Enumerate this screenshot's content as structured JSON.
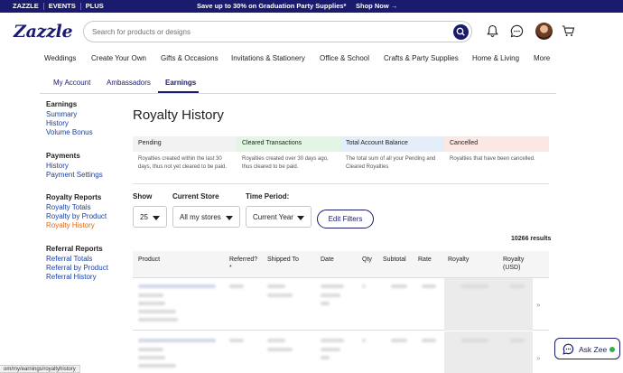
{
  "topbar": {
    "links": [
      "ZAZZLE",
      "EVENTS",
      "PLUS"
    ],
    "promo": "Save up to 30% on Graduation Party Supplies*",
    "shop_now": "Shop Now →",
    "bg_color": "#1a1a6e"
  },
  "header": {
    "logo": "Zazzle",
    "search_placeholder": "Search for products or designs",
    "icons": [
      "search-icon",
      "bell-icon",
      "chat-bubble-icon",
      "avatar",
      "cart-icon"
    ]
  },
  "catnav": [
    "Weddings",
    "Create Your Own",
    "Gifts & Occasions",
    "Invitations & Stationery",
    "Office & School",
    "Crafts & Party Supplies",
    "Home & Living",
    "More"
  ],
  "subtabs": [
    "My Account",
    "Ambassadors",
    "Earnings"
  ],
  "active_subtab": "Earnings",
  "sidebar": {
    "earnings": {
      "heading": "Earnings",
      "links": [
        "Summary",
        "History",
        "Volume Bonus"
      ]
    },
    "payments": {
      "heading": "Payments",
      "links": [
        "History",
        "Payment Settings"
      ]
    },
    "royalty": {
      "heading": "Royalty Reports",
      "links": [
        "Royalty Totals",
        "Royalty by Product",
        "Royalty History"
      ]
    },
    "referral": {
      "heading": "Referral Reports",
      "links": [
        "Referral Totals",
        "Referral by Product",
        "Referral History"
      ]
    }
  },
  "page_title": "Royalty History",
  "info": [
    {
      "title": "Pending",
      "body": "Royalties created within the last 30 days, thus not yet cleared to be paid.",
      "color": "#f2f2f2"
    },
    {
      "title": "Cleared Transactions",
      "body": "Royalties created over 30 days ago, thus cleared to be paid.",
      "color": "#e3f6e3"
    },
    {
      "title": "Total Account Balance",
      "body": "The total sum of all your Pending and Cleared Royalties",
      "color": "#e3eef8"
    },
    {
      "title": "Cancelled",
      "body": "Royalties that have been cancelled.",
      "color": "#fbe7e3"
    }
  ],
  "filters": {
    "show_label": "Show",
    "show_value": "25",
    "store_label": "Current Store",
    "store_value": "All my stores",
    "period_label": "Time Period:",
    "period_value": "Current Year",
    "edit_button": "Edit Filters"
  },
  "results_count": "10266 results",
  "table": {
    "headers": [
      "Product",
      "Referred?",
      "*",
      "Shipped To",
      "Date",
      "Qty",
      "Subtotal",
      "Rate",
      "Royalty",
      "Royalty",
      "(USD)"
    ]
  },
  "chat_label": "Ask Zee",
  "status_url": "om/my/earnings/royaltyhistory"
}
